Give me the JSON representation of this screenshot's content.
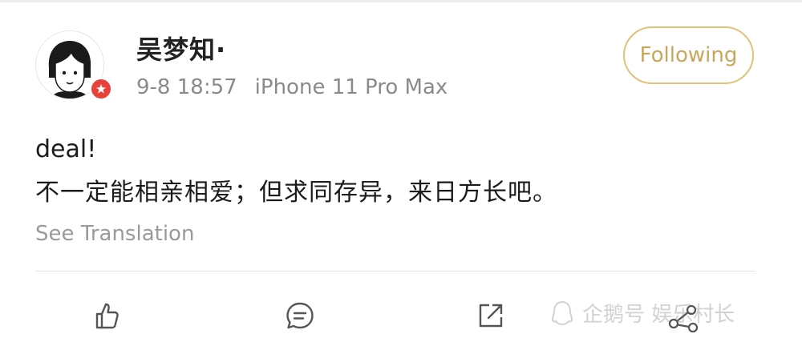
{
  "profile": {
    "username": "吴梦知·",
    "time": "9-8 18:57",
    "device": "iPhone 11 Pro Max",
    "avatar_icon": "cartoon-girl-avatar",
    "badge_icon": "verified-badge",
    "badge_color": "#e8413a"
  },
  "follow_button": {
    "label": "Following",
    "color": "#c9a65a"
  },
  "post": {
    "line1": "deal!",
    "line2": "不一定能相亲相爱；但求同存异，来日方长吧。"
  },
  "translate": {
    "label": "See Translation"
  },
  "actions": [
    {
      "icon": "thumbs-up-icon"
    },
    {
      "icon": "comment-icon"
    },
    {
      "icon": "share-icon"
    }
  ],
  "watermark": {
    "text": "企鹅号 娱乐村长"
  }
}
